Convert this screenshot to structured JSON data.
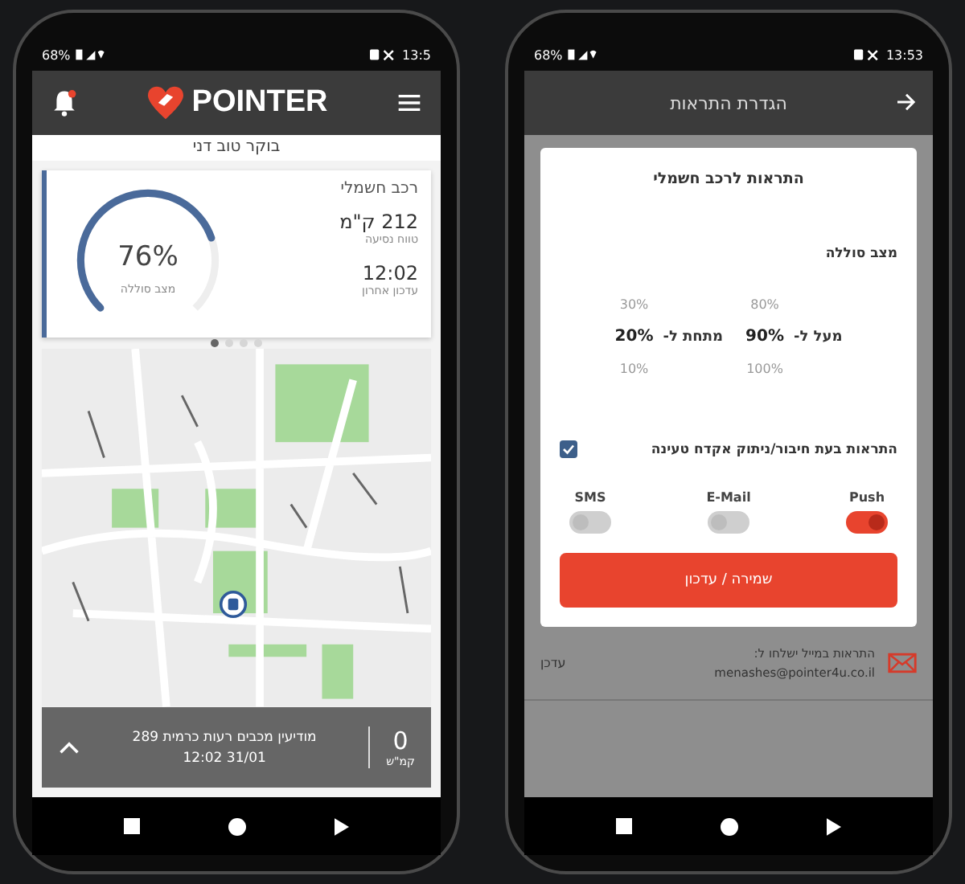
{
  "home_screen": {
    "status_bar": {
      "battery": "68%",
      "time": "13:5"
    },
    "header": {
      "logo": "POINTER",
      "notification": true
    },
    "greeting": "בוקר טוב דני",
    "vehicle_card": {
      "title": "רכב חשמלי",
      "range": {
        "value": "212 ק\"מ",
        "label": "טווח נסיעה"
      },
      "last_update": {
        "value": "12:02",
        "label": "עדכון אחרון"
      },
      "battery": {
        "level": 0.76,
        "reading": "76%",
        "label": "מצב סוללה"
      }
    },
    "pager_dots": [
      {
        "selected": true
      },
      {
        "selected": false
      },
      {
        "selected": false
      },
      {
        "selected": false
      }
    ],
    "map_panel": {
      "speed": {
        "value": "0",
        "unit": "קמ\"ש"
      },
      "address": "מודיעין מכבים רעות כרמית 289",
      "timestamp": "31/01 12:02"
    }
  },
  "alerts_screen": {
    "status_bar": {
      "battery": "68%",
      "time": "13:53"
    },
    "header": {
      "title": "הגדרת התראות"
    },
    "card": {
      "title": "התראות לרכב חשמלי",
      "section_label": "מצב סוללה",
      "pickers": [
        {
          "label": "מעל ל-",
          "options": [
            {
              "value": "80%",
              "selected": false
            },
            {
              "value": "90%",
              "selected": true
            },
            {
              "value": "100%",
              "selected": false
            }
          ]
        },
        {
          "label": "מתחת ל-",
          "options": [
            {
              "value": "30%",
              "selected": false
            },
            {
              "value": "20%",
              "selected": true
            },
            {
              "value": "10%",
              "selected": false
            }
          ]
        }
      ],
      "charger_alert": {
        "label": "התראות בעת חיבור/ניתוק אקדח טעינה",
        "checked": true
      },
      "channels": [
        {
          "label": "Push",
          "on": true
        },
        {
          "label": "E-Mail",
          "on": false
        },
        {
          "label": "SMS",
          "on": false
        }
      ],
      "save_button": "שמירה / עדכון"
    },
    "email_footer": {
      "label": "התראות במייל ישלחו ל:",
      "email": "menashes@pointer4u.co.il",
      "edit": "עדכן"
    }
  }
}
